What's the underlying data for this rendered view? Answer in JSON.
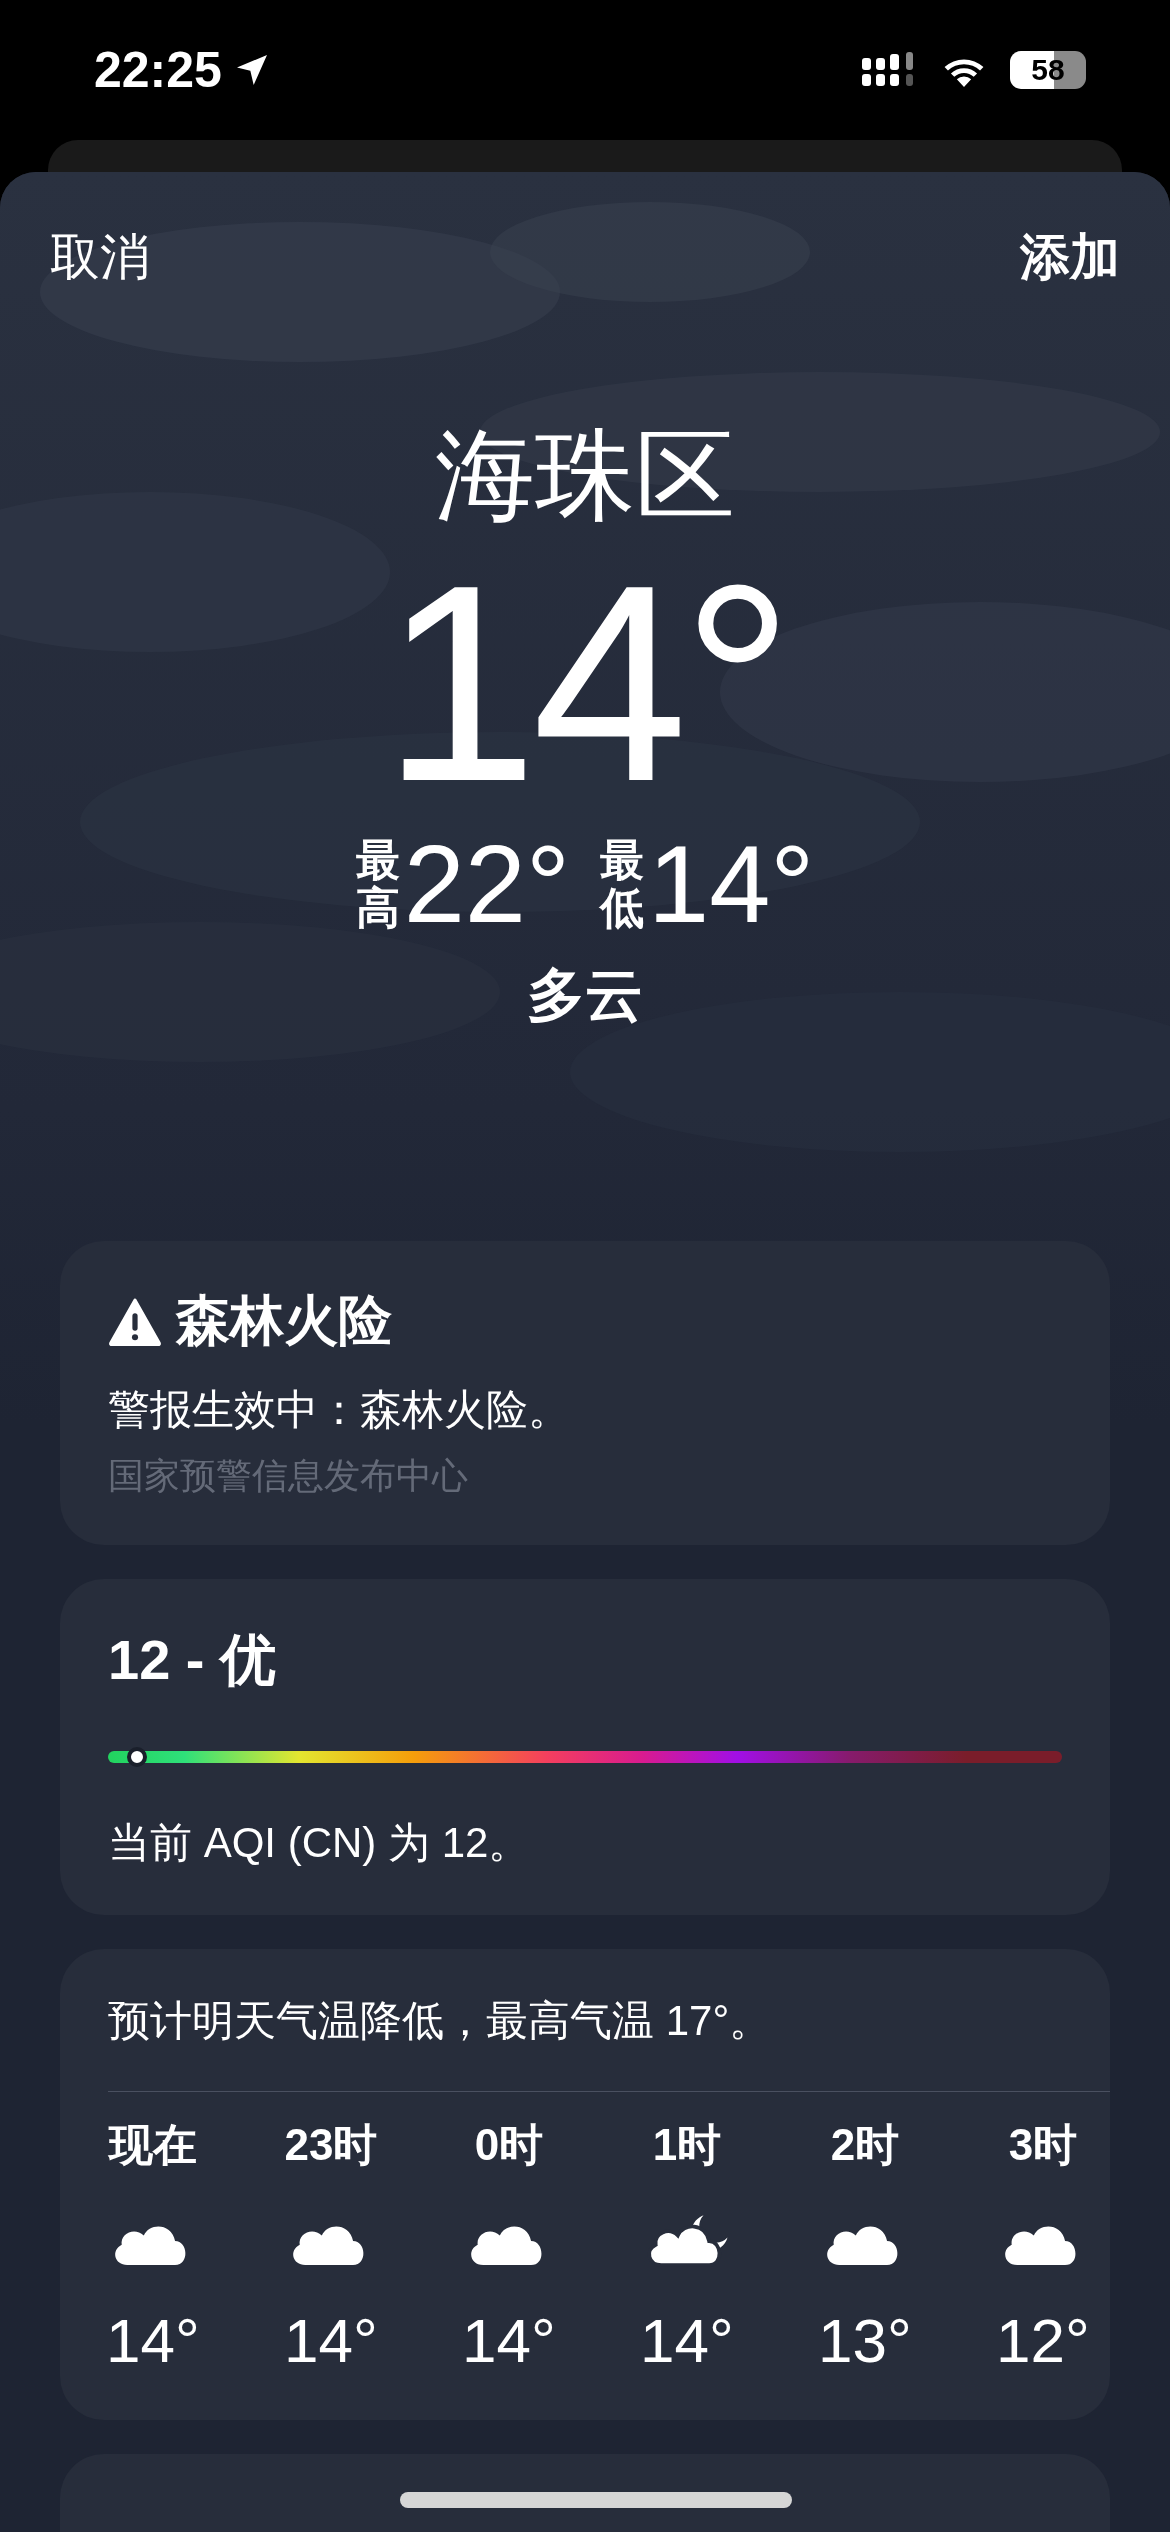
{
  "status_bar": {
    "time": "22:25",
    "battery": "58"
  },
  "nav": {
    "cancel": "取消",
    "add": "添加"
  },
  "current": {
    "location": "海珠区",
    "temperature": "14°",
    "high_label": "最高",
    "high": "22°",
    "low_label": "最低",
    "low": "14°",
    "condition": "多云"
  },
  "alert": {
    "title": "森林火险",
    "message": "警报生效中：森林火险。",
    "source": "国家预警信息发布中心"
  },
  "air_quality": {
    "title": "12 - 优",
    "level": 0.03,
    "description": "当前 AQI (CN) 为 12。"
  },
  "hourly": {
    "summary": "预计明天气温降低，最高气温 17°。",
    "hours": [
      {
        "time": "现在",
        "kind": "cloud",
        "temperature": "14°"
      },
      {
        "time": "23时",
        "kind": "cloud",
        "temperature": "14°"
      },
      {
        "time": "0时",
        "kind": "cloud",
        "temperature": "14°"
      },
      {
        "time": "1时",
        "kind": "moon-cloud",
        "temperature": "14°"
      },
      {
        "time": "2时",
        "kind": "cloud",
        "temperature": "13°"
      },
      {
        "time": "3时",
        "kind": "cloud",
        "temperature": "12°"
      }
    ]
  }
}
